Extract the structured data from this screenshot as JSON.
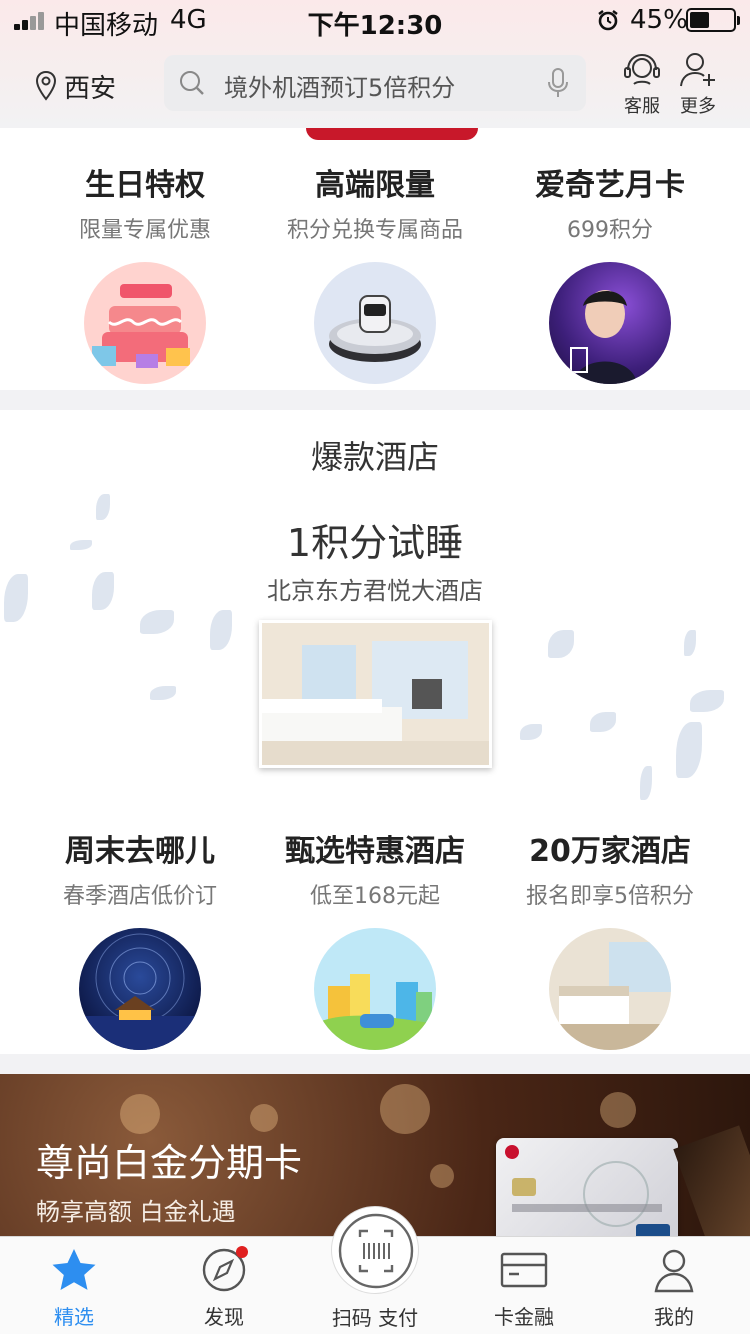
{
  "status_bar": {
    "carrier": "中国移动",
    "network": "4G",
    "time": "下午12:30",
    "battery_pct": "45%",
    "battery_level": 0.45
  },
  "header": {
    "location": "西安",
    "search_placeholder": "境外机酒预订5倍积分",
    "service_label": "客服",
    "more_label": "更多"
  },
  "privileges": [
    {
      "title": "生日特权",
      "subtitle": "限量专属优惠"
    },
    {
      "title": "高端限量",
      "subtitle": "积分兑换专属商品"
    },
    {
      "title": "爱奇艺月卡",
      "subtitle": "699积分"
    }
  ],
  "hotels": {
    "section_title": "爆款酒店",
    "promo_title": "1积分试睡",
    "promo_hotel": "北京东方君悦大酒店",
    "items": [
      {
        "title": "周末去哪儿",
        "subtitle": "春季酒店低价订"
      },
      {
        "title": "甄选特惠酒店",
        "subtitle": "低至168元起"
      },
      {
        "title": "20万家酒店",
        "subtitle": "报名即享5倍积分"
      }
    ]
  },
  "card_banner": {
    "title": "尊尚白金分期卡",
    "subtitle": "畅享高额 白金礼遇"
  },
  "tabbar": {
    "tabs": [
      {
        "label": "精选",
        "active": true
      },
      {
        "label": "发现"
      },
      {
        "label": "扫码 支付"
      },
      {
        "label": "卡金融"
      },
      {
        "label": "我的"
      }
    ]
  },
  "colors": {
    "accent": "#2d8ef0",
    "text": "#333333",
    "muted": "#777777",
    "badge": "#e02020"
  }
}
